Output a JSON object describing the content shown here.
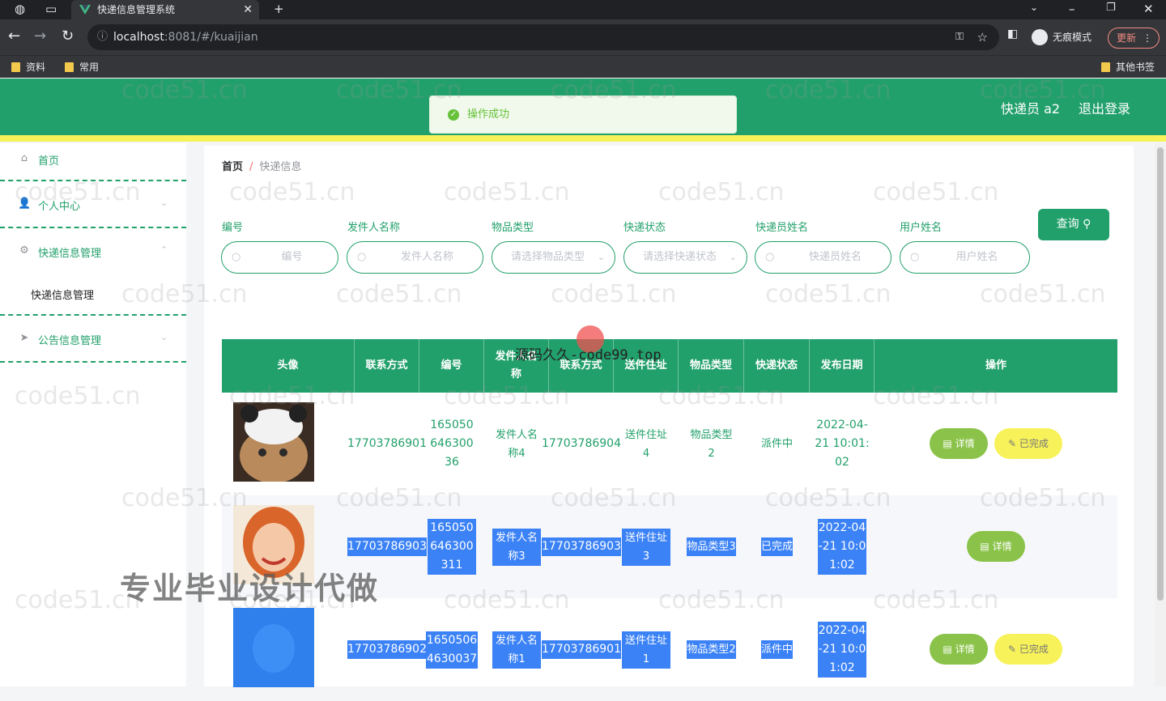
{
  "browser": {
    "tab_title": "快递信息管理系统",
    "url_host": "localhost",
    "url_rest": ":8081/#/kuaijian",
    "incognito_label": "无痕模式",
    "update_label": "更新",
    "bookmarks": [
      "资料",
      "常用"
    ],
    "other_bookmarks": "其他书签"
  },
  "header": {
    "user_label": "快递员 a2",
    "logout_label": "退出登录"
  },
  "toast": {
    "message": "操作成功"
  },
  "sidebar": {
    "home": "首页",
    "personal": "个人中心",
    "express_mgmt": "快递信息管理",
    "express_sub": "快递信息管理",
    "notice_mgmt": "公告信息管理"
  },
  "breadcrumb": {
    "home": "首页",
    "separator": "/",
    "current": "快递信息"
  },
  "filters": [
    {
      "label": "编号",
      "placeholder": "编号"
    },
    {
      "label": "发件人名称",
      "placeholder": "发件人名称"
    },
    {
      "label": "物品类型",
      "placeholder": "请选择物品类型"
    },
    {
      "label": "快递状态",
      "placeholder": "请选择快递状态"
    },
    {
      "label": "快递员姓名",
      "placeholder": "快递员姓名"
    },
    {
      "label": "用户姓名",
      "placeholder": "用户姓名"
    }
  ],
  "search_button": "查询",
  "table": {
    "headers": [
      "头像",
      "联系方式",
      "编号",
      "发件人名称",
      "联系方式",
      "送件住址",
      "物品类型",
      "快递状态",
      "发布日期",
      "操作"
    ],
    "rows": [
      {
        "contact": "17703786901",
        "number": "16505064630036",
        "sender": "发件人名称4",
        "sender_contact": "17703786904",
        "address": "送件住址4",
        "item_type": "物品类型2",
        "status": "派件中",
        "date": "2022-04-21 10:01:02",
        "detail": "详情",
        "done": "已完成"
      },
      {
        "contact": "17703786903",
        "number": "165050646300311",
        "sender": "发件人名称3",
        "sender_contact": "17703786903",
        "address": "送件住址3",
        "item_type": "物品类型3",
        "status": "已完成",
        "date": "2022-04-21 10:01:02",
        "detail": "详情",
        "done": ""
      },
      {
        "contact": "17703786902",
        "number": "16505064630037",
        "sender": "发件人名称1",
        "sender_contact": "17703786901",
        "address": "送件住址1",
        "item_type": "物品类型2",
        "status": "派件中",
        "date": "2022-04-21 10:01:02",
        "detail": "详情",
        "done": "已完成"
      }
    ]
  },
  "overlay": {
    "promo": "专业毕业设计代做",
    "site": "源码久久-code99.top",
    "watermark": "code51.cn"
  }
}
